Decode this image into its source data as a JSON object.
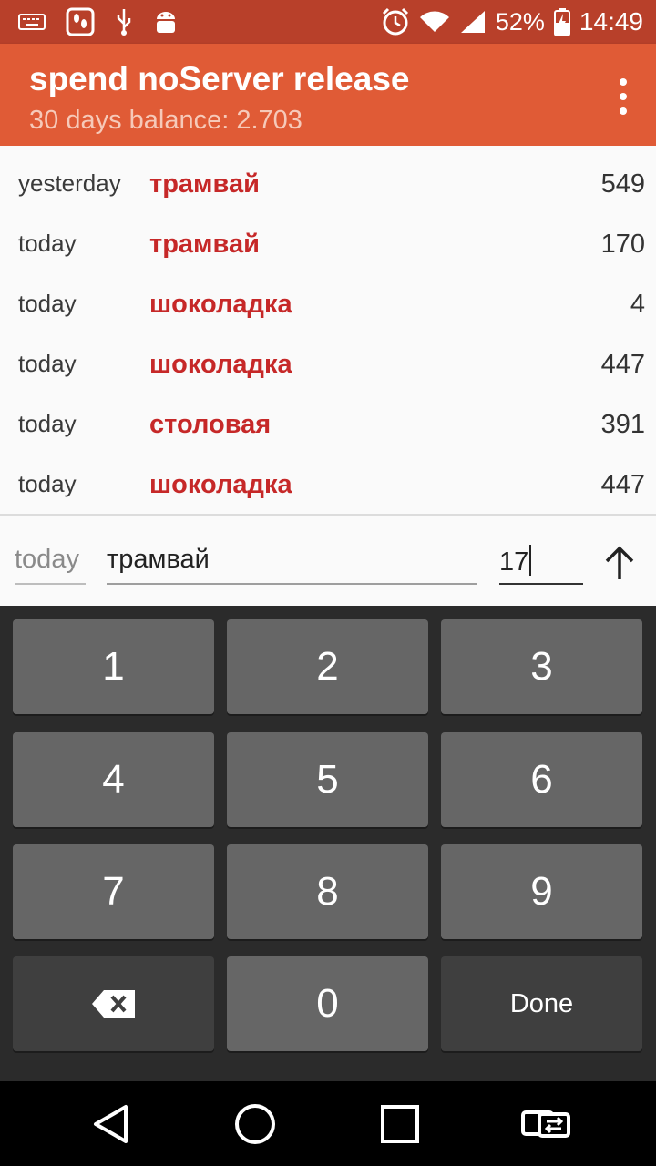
{
  "status_bar": {
    "battery": "52%",
    "time": "14:49"
  },
  "app_bar": {
    "title": "spend noServer release",
    "subtitle": "30 days balance: 2.703"
  },
  "entries": [
    {
      "date": "yesterday",
      "category": "трамвай",
      "amount": "549"
    },
    {
      "date": "today",
      "category": "трамвай",
      "amount": "170"
    },
    {
      "date": "today",
      "category": "шоколадка",
      "amount": "4"
    },
    {
      "date": "today",
      "category": "шоколадка",
      "amount": "447"
    },
    {
      "date": "today",
      "category": "столовая",
      "amount": "391"
    },
    {
      "date": "today",
      "category": "шоколадка",
      "amount": "447"
    }
  ],
  "input": {
    "date": "today",
    "category": "трамвай",
    "amount": "17"
  },
  "keyboard": {
    "keys": [
      "1",
      "2",
      "3",
      "4",
      "5",
      "6",
      "7",
      "8",
      "9",
      "0"
    ],
    "done_label": "Done"
  },
  "colors": {
    "status_bar": "#b8402a",
    "app_bar": "#e05b36",
    "category_text": "#c62828"
  }
}
